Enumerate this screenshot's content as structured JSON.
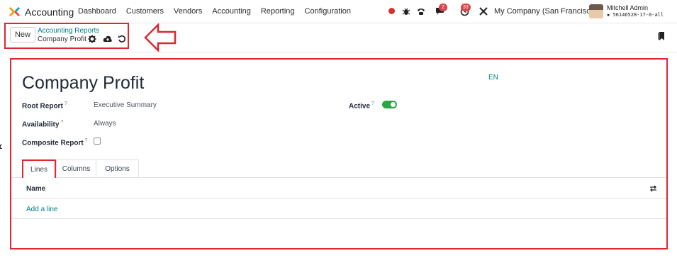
{
  "navbar": {
    "app_name": "Accounting",
    "menu": [
      "Dashboard",
      "Customers",
      "Vendors",
      "Accounting",
      "Reporting",
      "Configuration"
    ],
    "messages_badge": "2",
    "activity_badge": "33",
    "company": "My Company (San Francisco)",
    "user_name": "Mitchell Admin",
    "database": "56146528-17-0-all"
  },
  "control_panel": {
    "new_label": "New",
    "breadcrumb_parent": "Accounting Reports",
    "breadcrumb_current": "Company Profit"
  },
  "form": {
    "title": "Company Profit",
    "language": "EN",
    "root_report_label": "Root Report",
    "root_report_value": "Executive Summary",
    "availability_label": "Availability",
    "availability_value": "Always",
    "composite_label": "Composite Report",
    "composite_checked": false,
    "active_label": "Active",
    "active_on": true,
    "help_mark": "?"
  },
  "tabs": [
    {
      "label": "Lines",
      "active": true
    },
    {
      "label": "Columns",
      "active": false
    },
    {
      "label": "Options",
      "active": false
    }
  ],
  "lines_table": {
    "column_name": "Name",
    "add_line_label": "Add a line"
  },
  "colors": {
    "accent": "#017e84",
    "highlight": "#e0262f",
    "toggle": "#28a745",
    "badge": "#d9434b"
  }
}
